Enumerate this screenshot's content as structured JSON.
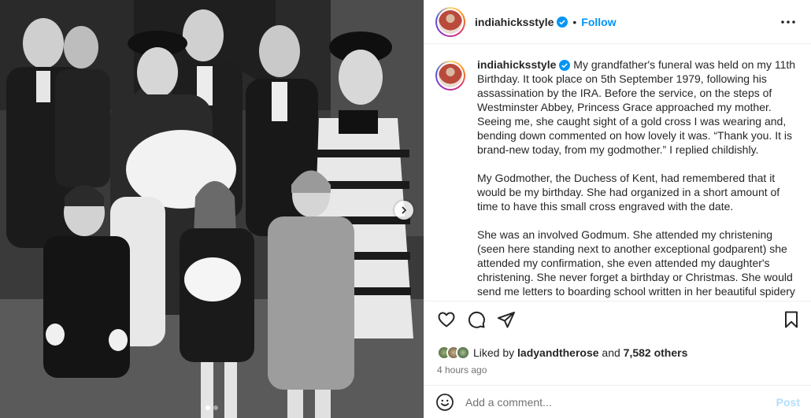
{
  "post": {
    "username": "indiahicksstyle",
    "follow_label": "Follow",
    "separator": "•",
    "caption_paragraphs": [
      "My grandfather's funeral was held on my 11th Birthday. It took place on 5th September 1979, following his assassination by the IRA. Before the service, on the steps of Westminster Abbey, Princess Grace approached my mother. Seeing me, she caught sight of a gold cross I was wearing and, bending down commented on how lovely it was. “Thank you. It is brand-new today, from my godmother.” I replied childishly.",
      "My Godmother, the Duchess of Kent, had remembered that it would be my birthday. She had organized in a short amount of time to have this small cross engraved with the date.",
      "She was an involved Godmum. She attended my christening (seen here standing next to another exceptional godparent) she attended my confirmation, she even attended my daughter's christening. She never forget a birthday or Christmas. She would send me letters to boarding school written in her beautiful spidery hand writing. A"
    ],
    "likes": {
      "prefix": "Liked by",
      "user": "ladyandtherose",
      "middle": "and",
      "count": "7,582 others"
    },
    "time_ago": "4 hours ago",
    "comment_placeholder": "Add a comment...",
    "post_label": "Post",
    "carousel": {
      "slides": 2,
      "active_index": 1
    }
  },
  "icons": {
    "verified": "verified-badge-icon",
    "more": "more-options-icon",
    "like": "heart-icon",
    "comment": "comment-bubble-icon",
    "share": "paper-plane-icon",
    "save": "bookmark-icon",
    "emoji": "smiley-icon",
    "next": "chevron-right-icon"
  },
  "colors": {
    "accent": "#0095f6",
    "verified": "#0095f6",
    "post_disabled": "#b2dffc",
    "muted": "#737373",
    "text": "#262626"
  }
}
